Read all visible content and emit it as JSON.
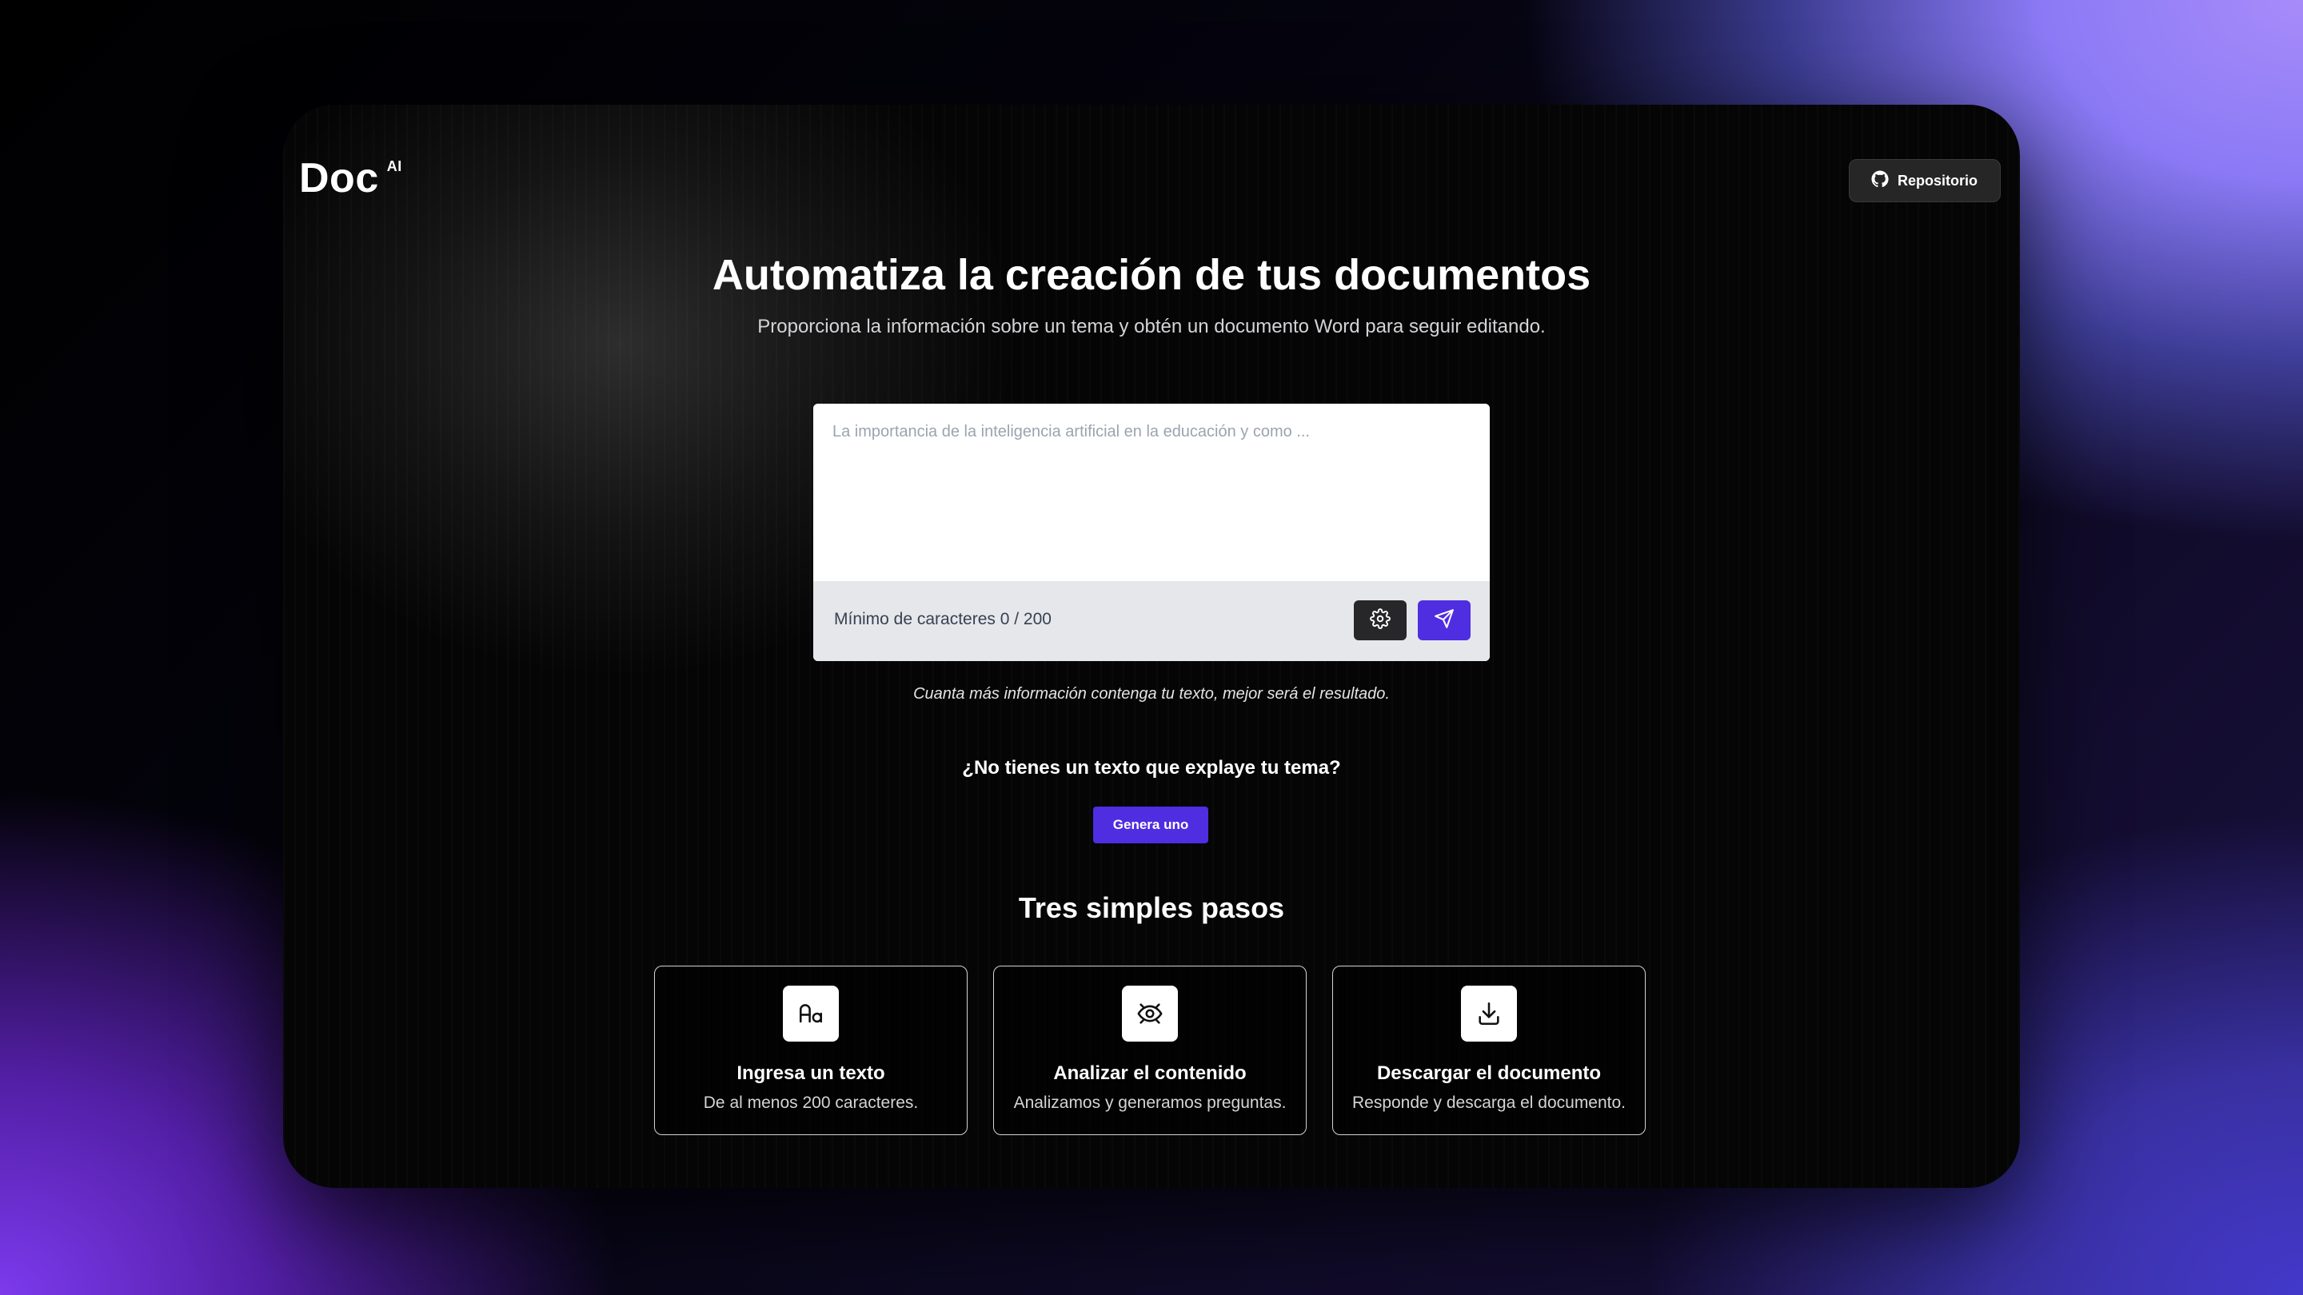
{
  "header": {
    "logo_text": "Doc",
    "logo_badge": "AI",
    "repo_button_label": "Repositorio",
    "repo_icon": "github-icon"
  },
  "hero": {
    "title": "Automatiza la creación de tus documentos",
    "subtitle": "Proporciona la información sobre un tema y obtén un documento Word para seguir editando."
  },
  "input": {
    "placeholder": "La importancia de la inteligencia artificial en la educación y como ...",
    "value": "",
    "char_count_label": "Mínimo de caracteres 0 / 200",
    "settings_icon": "gear-icon",
    "send_icon": "send-icon"
  },
  "hint": "Cuanta más información contenga tu texto, mejor será el resultado.",
  "generate": {
    "question": "¿No tienes un texto que explaye tu tema?",
    "button_label": "Genera uno"
  },
  "steps": {
    "title": "Tres simples pasos",
    "items": [
      {
        "icon": "text-format-icon",
        "title": "Ingresa un texto",
        "description": "De al menos 200 caracteres."
      },
      {
        "icon": "eye-scan-icon",
        "title": "Analizar el contenido",
        "description": "Analizamos y generamos preguntas."
      },
      {
        "icon": "download-icon",
        "title": "Descargar el documento",
        "description": "Responde y descarga el documento."
      }
    ]
  },
  "colors": {
    "accent": "#4f2de0",
    "window_bg": "#050505",
    "footer_bg": "#e5e7eb"
  }
}
